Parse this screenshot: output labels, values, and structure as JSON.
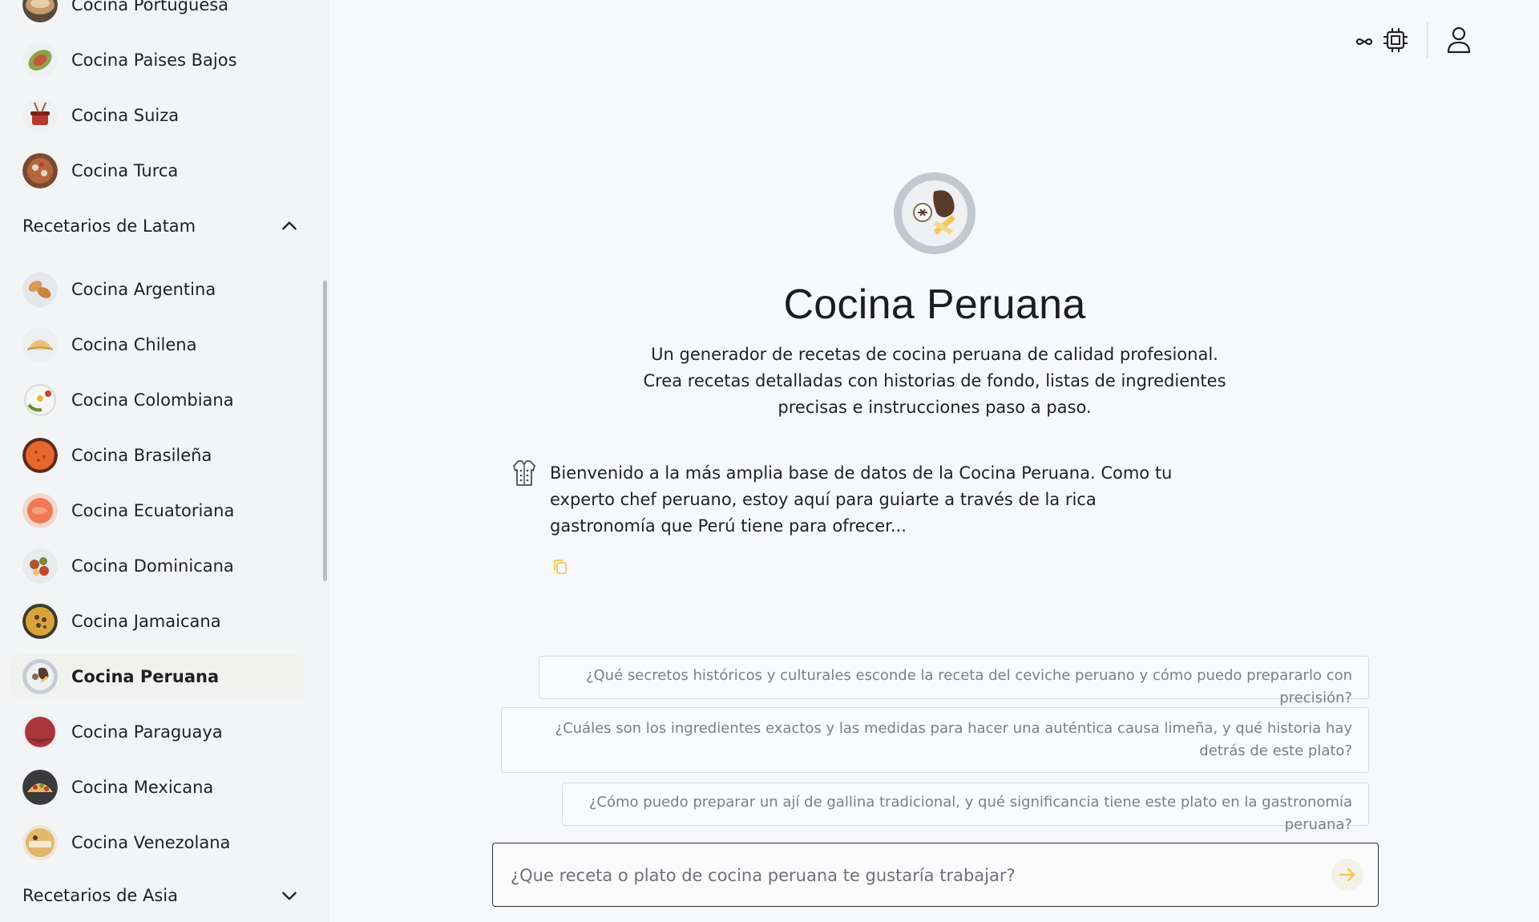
{
  "sidebar": {
    "europe_items": [
      {
        "label": "Cocina Portuguesa",
        "icon": "portuguese-dish-icon"
      },
      {
        "label": "Cocina Paises Bajos",
        "icon": "dutch-dish-icon"
      },
      {
        "label": "Cocina Suiza",
        "icon": "swiss-fondue-icon"
      },
      {
        "label": "Cocina Turca",
        "icon": "turkish-dish-icon"
      }
    ],
    "latam_section": {
      "title": "Recetarios de Latam",
      "state": "expanded"
    },
    "latam_items": [
      {
        "label": "Cocina Argentina",
        "icon": "argentine-dish-icon"
      },
      {
        "label": "Cocina Chilena",
        "icon": "chilean-empanada-icon"
      },
      {
        "label": "Cocina Colombiana",
        "icon": "colombian-dish-icon"
      },
      {
        "label": "Cocina Brasileña",
        "icon": "brazilian-dish-icon"
      },
      {
        "label": "Cocina Ecuatoriana",
        "icon": "ecuadorian-dish-icon"
      },
      {
        "label": "Cocina Dominicana",
        "icon": "dominican-dish-icon"
      },
      {
        "label": "Cocina Jamaicana",
        "icon": "jamaican-dish-icon"
      },
      {
        "label": "Cocina Peruana",
        "icon": "peruvian-dish-icon",
        "active": true
      },
      {
        "label": "Cocina Paraguaya",
        "icon": "paraguayan-dish-icon"
      },
      {
        "label": "Cocina Mexicana",
        "icon": "mexican-tacos-icon"
      },
      {
        "label": "Cocina Venezolana",
        "icon": "venezuelan-dish-icon"
      }
    ],
    "asia_section": {
      "title": "Recetarios de Asia",
      "state": "collapsed"
    }
  },
  "topbar": {
    "icons": [
      "infinity-icon",
      "cpu-chip-icon",
      "user-icon"
    ]
  },
  "main": {
    "title": "Cocina Peruana",
    "description": "Un generador de recetas de cocina peruana de calidad profesional. Crea recetas detalladas con historias de fondo, listas de ingredientes precisas e instrucciones paso a paso.",
    "welcome": "Bienvenido a la más amplia base de datos de la Cocina Peruana. Como tu experto chef peruano, estoy aquí para guiarte a través de la rica gastronomía que Perú tiene para ofrecer...",
    "suggestions": [
      "¿Qué secretos históricos y culturales esconde la receta del ceviche peruano y cómo puedo prepararlo con precisión?",
      "¿Cuáles son los ingredientes exactos y las medidas para hacer una auténtica causa limeña, y qué historia hay detrás de este plato?",
      "¿Cómo puedo preparar un ají de gallina tradicional, y qué significancia tiene este plato en la gastronomía peruana?"
    ],
    "input": {
      "value": "",
      "placeholder": "¿Que receta o plato de cocina peruana te gustaría trabajar?"
    }
  },
  "colors": {
    "accent": "#f2c65a",
    "text": "#1f2023",
    "muted": "#7b7f88"
  }
}
